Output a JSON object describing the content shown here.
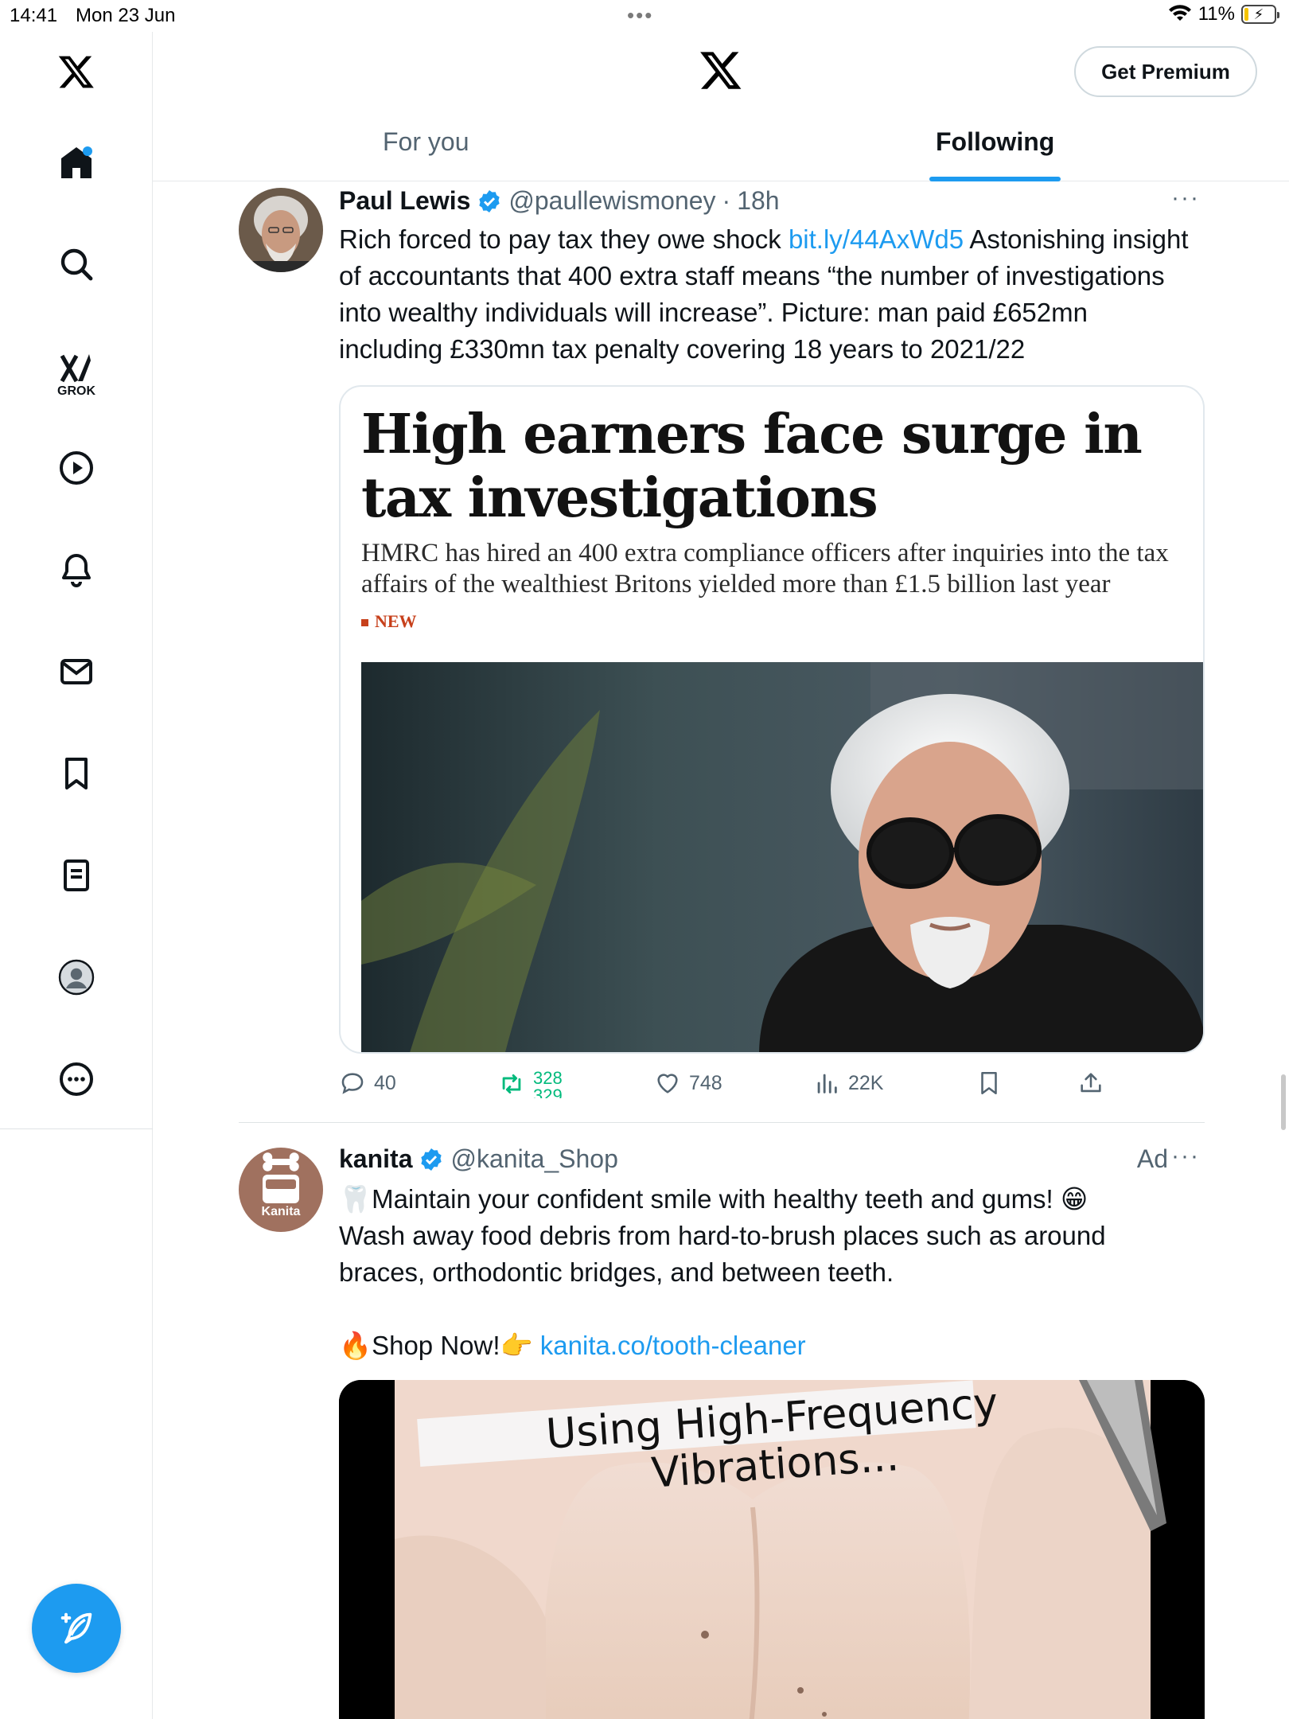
{
  "status_bar": {
    "time": "14:41",
    "date": "Mon 23 Jun",
    "battery": "11%"
  },
  "header": {
    "premium_button": "Get Premium",
    "tabs": [
      {
        "label": "For you",
        "active": false
      },
      {
        "label": "Following",
        "active": true
      }
    ]
  },
  "sidebar": {
    "items": [
      {
        "icon": "home-icon",
        "has_dot": true
      },
      {
        "icon": "search-icon"
      },
      {
        "icon": "grok-icon",
        "label": "GROK"
      },
      {
        "icon": "video-icon"
      },
      {
        "icon": "notifications-icon"
      },
      {
        "icon": "messages-icon"
      },
      {
        "icon": "bookmarks-icon"
      },
      {
        "icon": "lists-icon"
      },
      {
        "icon": "profile-icon"
      },
      {
        "icon": "more-icon"
      }
    ]
  },
  "tweets": [
    {
      "name": "Paul Lewis",
      "handle": "@paullewismoney",
      "dot": "·",
      "time": "18h",
      "text_before_link": "Rich forced to pay tax they owe shock ",
      "link": "bit.ly/44AxWd5",
      "text_after_link": " Astonishing insight of accountants that 400 extra staff means “the number of investigations into wealthy individuals will increase”. Picture: man paid £652mn including £330mn tax penalty covering 18 years to 2021/22",
      "card": {
        "headline": "High earners face surge in tax investigations",
        "subheadline": "HMRC has hired an 400 extra compliance officers after inquiries into the tax affairs of the wealthiest Britons yielded more than £1.5 billion last year",
        "badge": "NEW"
      },
      "stats": {
        "replies": "40",
        "retweets_top": "328",
        "retweets_bottom": "329",
        "likes": "748",
        "views": "22K"
      }
    },
    {
      "name": "kanita",
      "handle": "@kanita_Shop",
      "ad_label": "Ad",
      "avatar_text": "Kanita",
      "line1": "Maintain your confident smile with healthy teeth and gums! ",
      "line1_emoji": "😁",
      "line2": "Wash away food debris from hard-to-brush places such as around braces, orthodontic bridges, and between teeth.",
      "cta": "Shop Now!",
      "link": "kanita.co/tooth-cleaner",
      "media_caption_1": "Using High-Frequency",
      "media_caption_2": "Vibrations..."
    }
  ],
  "colors": {
    "accent": "#1d9bf0",
    "text_primary": "#0f1419",
    "text_secondary": "#536471",
    "retweet_green": "#00ba7c",
    "card_red": "#c7401b"
  }
}
